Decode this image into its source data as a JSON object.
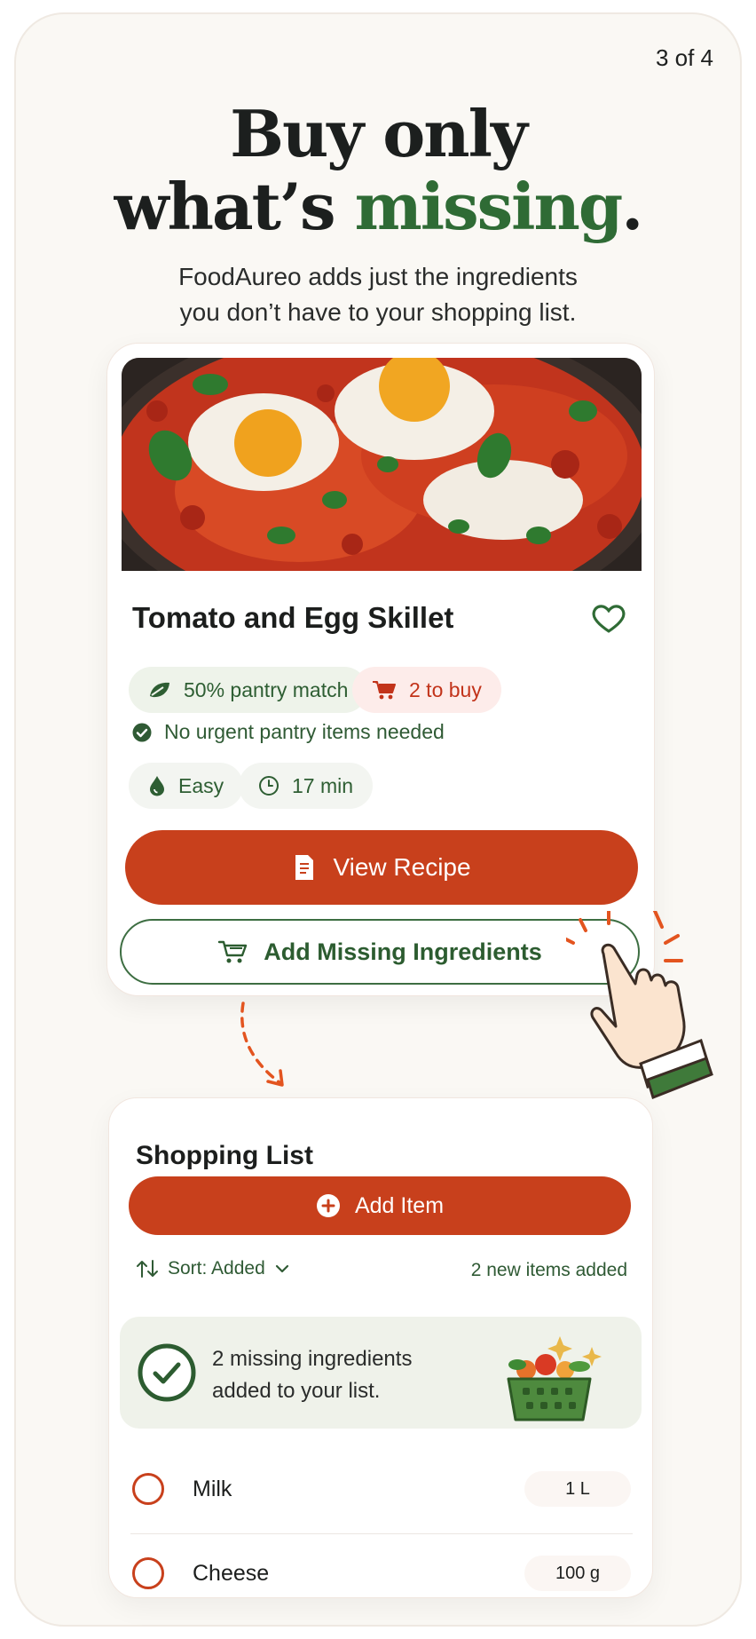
{
  "onboarding": {
    "step": "3 of 4",
    "headline_line1": "Buy only",
    "headline_line2_prefix": "what’s ",
    "headline_line2_accent": "missing",
    "headline_line2_suffix": ".",
    "subtitle_line1": "FoodAureo adds just the ingredients",
    "subtitle_line2": "you don’t have to your shopping list."
  },
  "recipe": {
    "title": "Tomato and Egg Skillet",
    "pantry_match": "50% pantry match",
    "to_buy": "2 to buy",
    "note": "No urgent pantry items needed",
    "difficulty": "Easy",
    "time": "17 min",
    "view_button": "View Recipe",
    "add_missing_button": "Add Missing Ingredients"
  },
  "shopping_list": {
    "title": "Shopping List",
    "add_button": "Add Item",
    "sort_label": "Sort: Added",
    "new_count": "2 new items added",
    "banner_line1": "2 missing ingredients",
    "banner_line2": "added to your list.",
    "items": [
      {
        "name": "Milk",
        "qty": "1 L"
      },
      {
        "name": "Cheese",
        "qty": "100 g"
      }
    ]
  },
  "colors": {
    "accent": "#c8401c",
    "brand_green": "#2f6b35",
    "background": "#faf8f4"
  },
  "icons": [
    "leaf-icon",
    "cart-icon",
    "check-circle-icon",
    "drop-icon",
    "clock-icon",
    "document-icon",
    "heart-icon",
    "plus-circle-icon",
    "sort-icon",
    "chevron-down-icon",
    "basket-icon",
    "pointing-hand-icon"
  ]
}
